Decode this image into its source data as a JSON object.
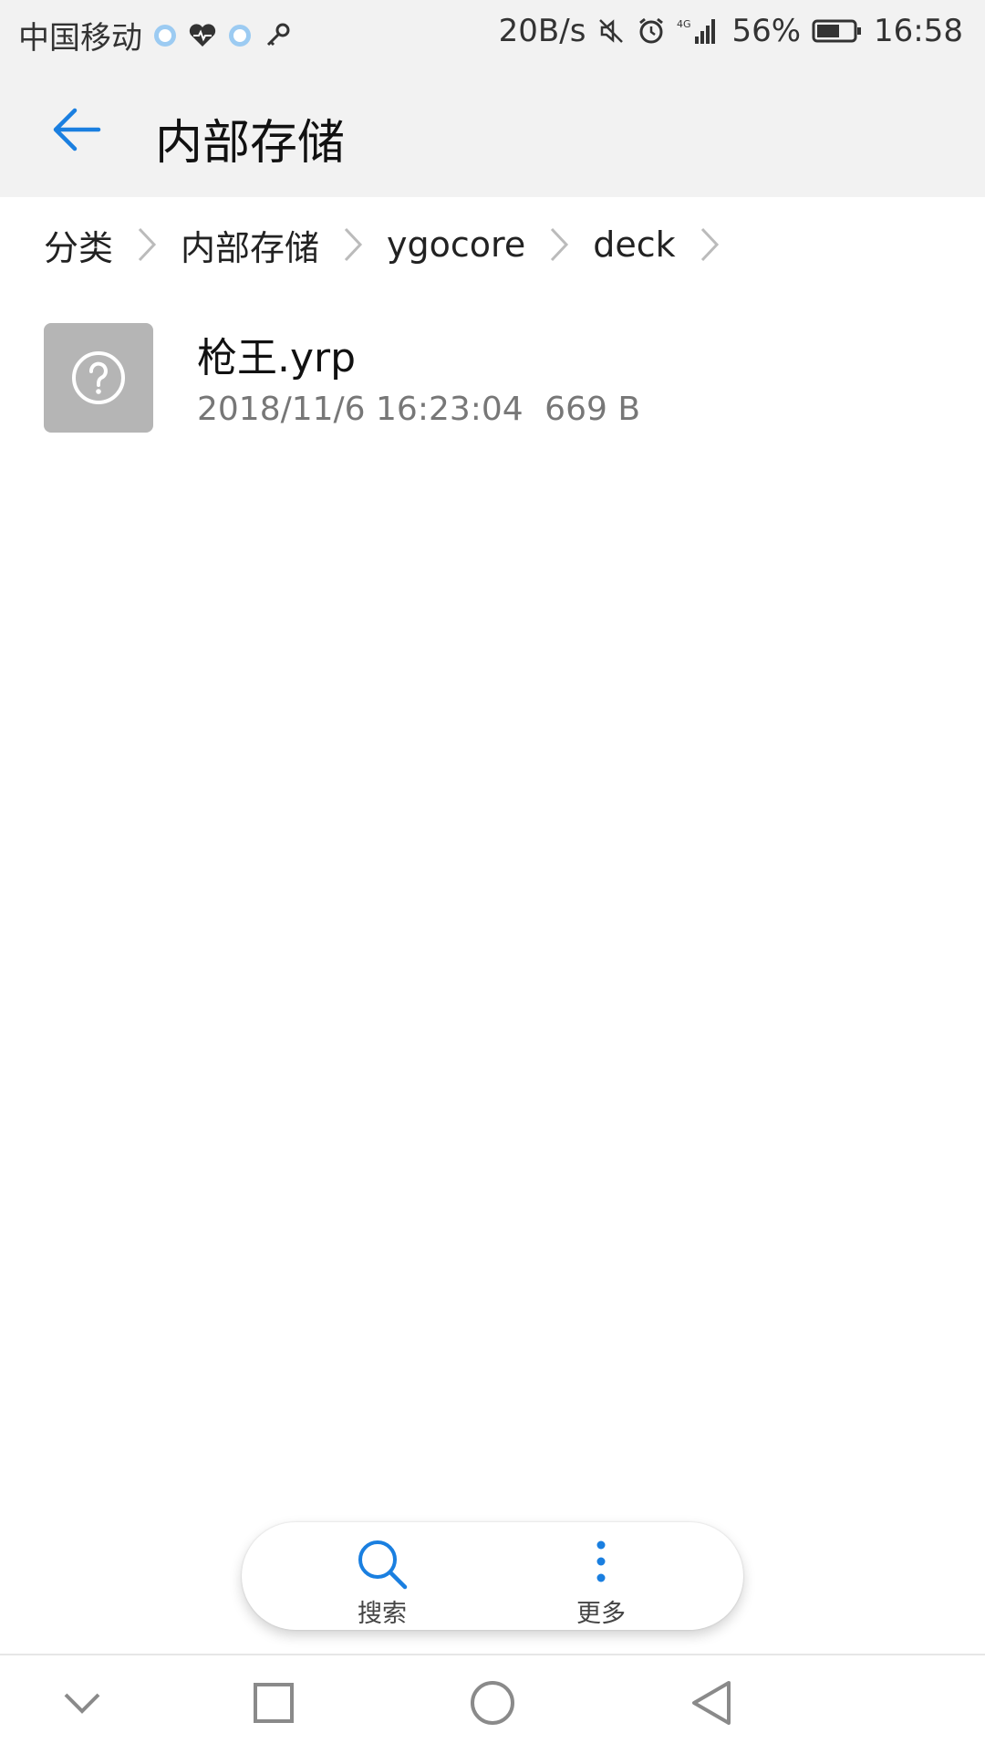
{
  "status_bar": {
    "carrier": "中国移动",
    "net_speed": "20B/s",
    "network": "4G",
    "battery_percent": "56%",
    "time": "16:58",
    "icons": [
      "cloud-icon",
      "heart-icon",
      "cloud-icon",
      "key-icon",
      "mute-icon",
      "alarm-icon",
      "signal-icon",
      "battery-icon"
    ]
  },
  "header": {
    "title": "内部存储",
    "back_icon": "back-arrow-icon"
  },
  "breadcrumb": {
    "items": [
      "分类",
      "内部存储",
      "ygocore",
      "deck"
    ]
  },
  "files": [
    {
      "name": "枪王.yrp",
      "date": "2018/11/6 16:23:04",
      "size": "669 B",
      "icon": "unknown-file-icon"
    }
  ],
  "toolbar": {
    "search_label": "搜索",
    "more_label": "更多"
  },
  "colors": {
    "accent": "#1a7fe0",
    "header_bg": "#f2f2f2",
    "thumb_bg": "#b5b5b5"
  }
}
